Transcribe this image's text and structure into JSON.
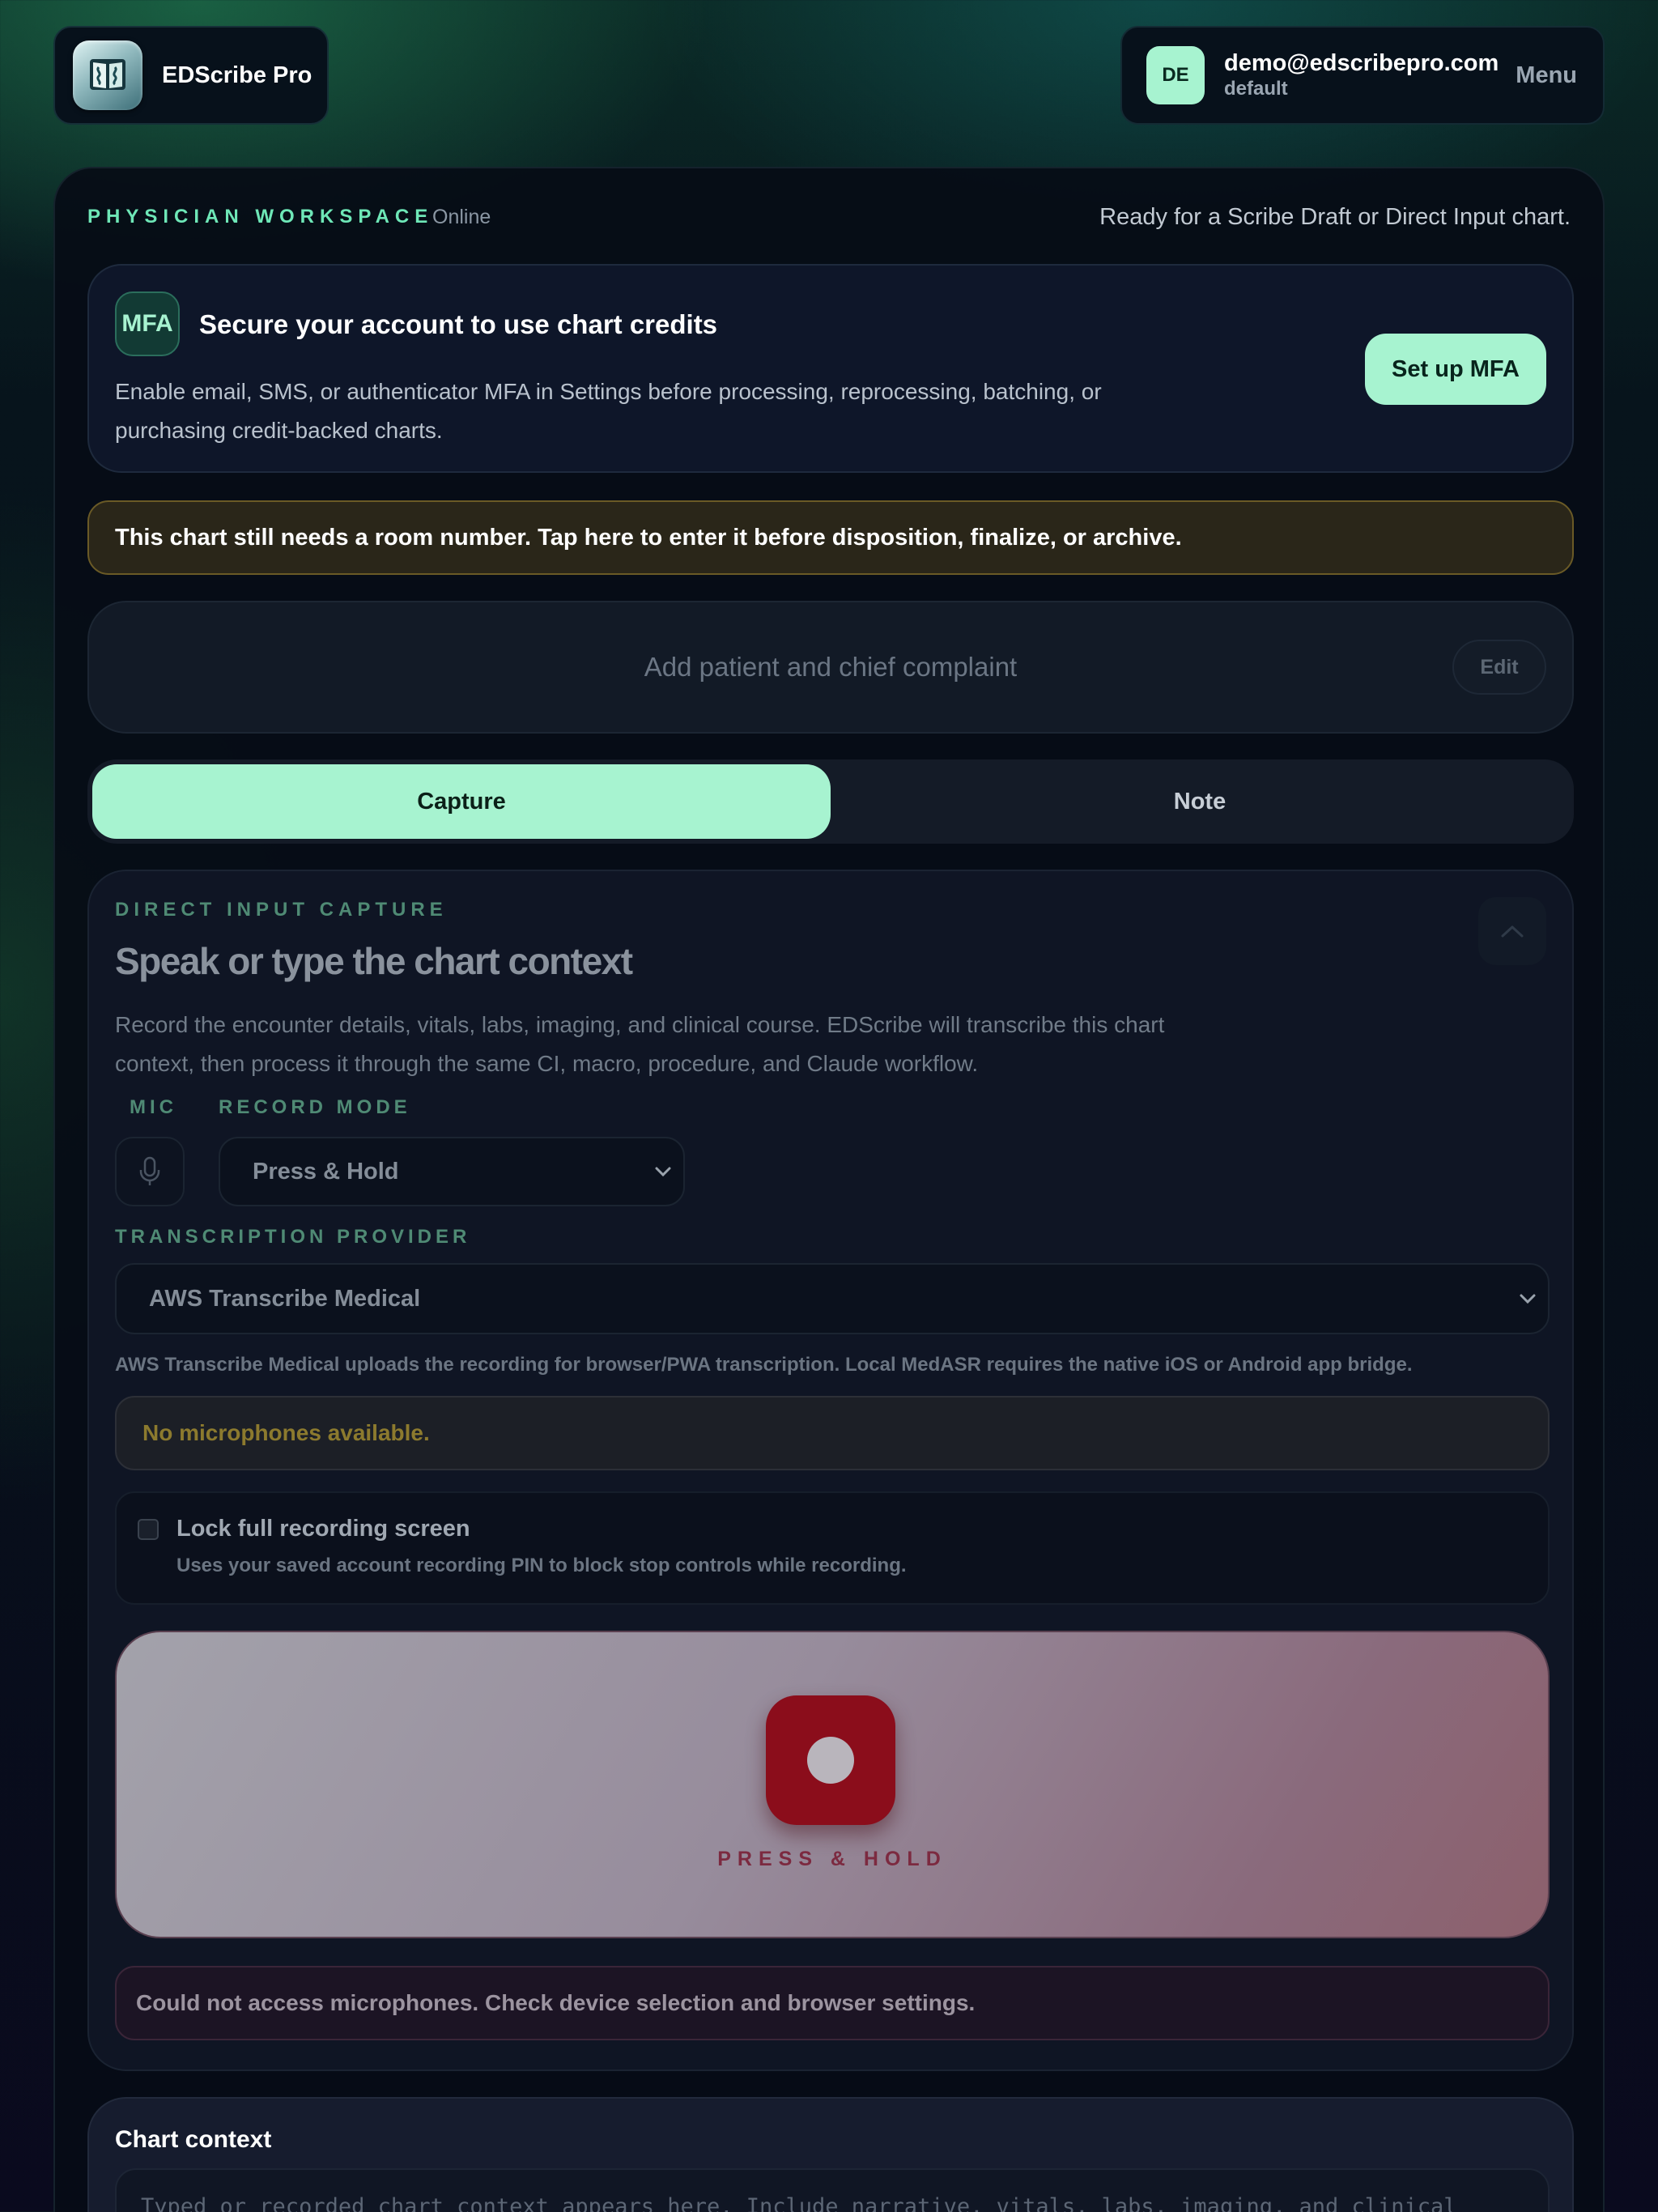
{
  "brand": {
    "name": "EDScribe Pro",
    "logo_icon": "book-logo-icon"
  },
  "account": {
    "initials": "DE",
    "email": "demo@edscribepro.com",
    "role": "default",
    "menu_label": "Menu"
  },
  "workspace": {
    "label": "PHYSICIAN WORKSPACE",
    "status": "Online",
    "ready_text": "Ready for a Scribe Draft or Direct Input chart."
  },
  "mfa": {
    "badge": "MFA",
    "title": "Secure your account to use chart credits",
    "body": "Enable email, SMS, or authenticator MFA in Settings before processing, reprocessing, batching, or purchasing credit-backed charts.",
    "button": "Set up MFA"
  },
  "room_warning": "This chart still needs a room number. Tap here to enter it before disposition, finalize, or archive.",
  "patient": {
    "placeholder": "Add patient and chief complaint",
    "edit_label": "Edit"
  },
  "tabs": [
    {
      "label": "Capture",
      "active": true
    },
    {
      "label": "Note",
      "active": false
    }
  ],
  "capture": {
    "kicker": "DIRECT INPUT CAPTURE",
    "title": "Speak or type the chart context",
    "description": "Record the encounter details, vitals, labs, imaging, and clinical course. EDScribe will transcribe this chart context, then process it through the same CI, macro, procedure, and Claude workflow.",
    "mic_label": "MIC",
    "record_mode_label": "RECORD MODE",
    "record_mode_value": "Press & Hold",
    "provider_label": "TRANSCRIPTION PROVIDER",
    "provider_value": "AWS Transcribe Medical",
    "provider_help": "AWS Transcribe Medical uploads the recording for browser/PWA transcription. Local MedASR requires the native iOS or Android app bridge.",
    "no_mic": "No microphones available.",
    "lock_title": "Lock full recording screen",
    "lock_sub": "Uses your saved account recording PIN to block stop controls while recording.",
    "lock_checked": false,
    "record_label": "PRESS & HOLD",
    "mic_error": "Could not access microphones. Check device selection and browser settings."
  },
  "context": {
    "title": "Chart context",
    "placeholder": "Typed or recorded chart context appears here. Include narrative, vitals, labs, imaging, and clinical"
  },
  "colors": {
    "accent": "#a7f3d0",
    "accent_text": "#6ee7b7",
    "record": "#8b0d1b",
    "warning_border": "#6a5a26"
  }
}
